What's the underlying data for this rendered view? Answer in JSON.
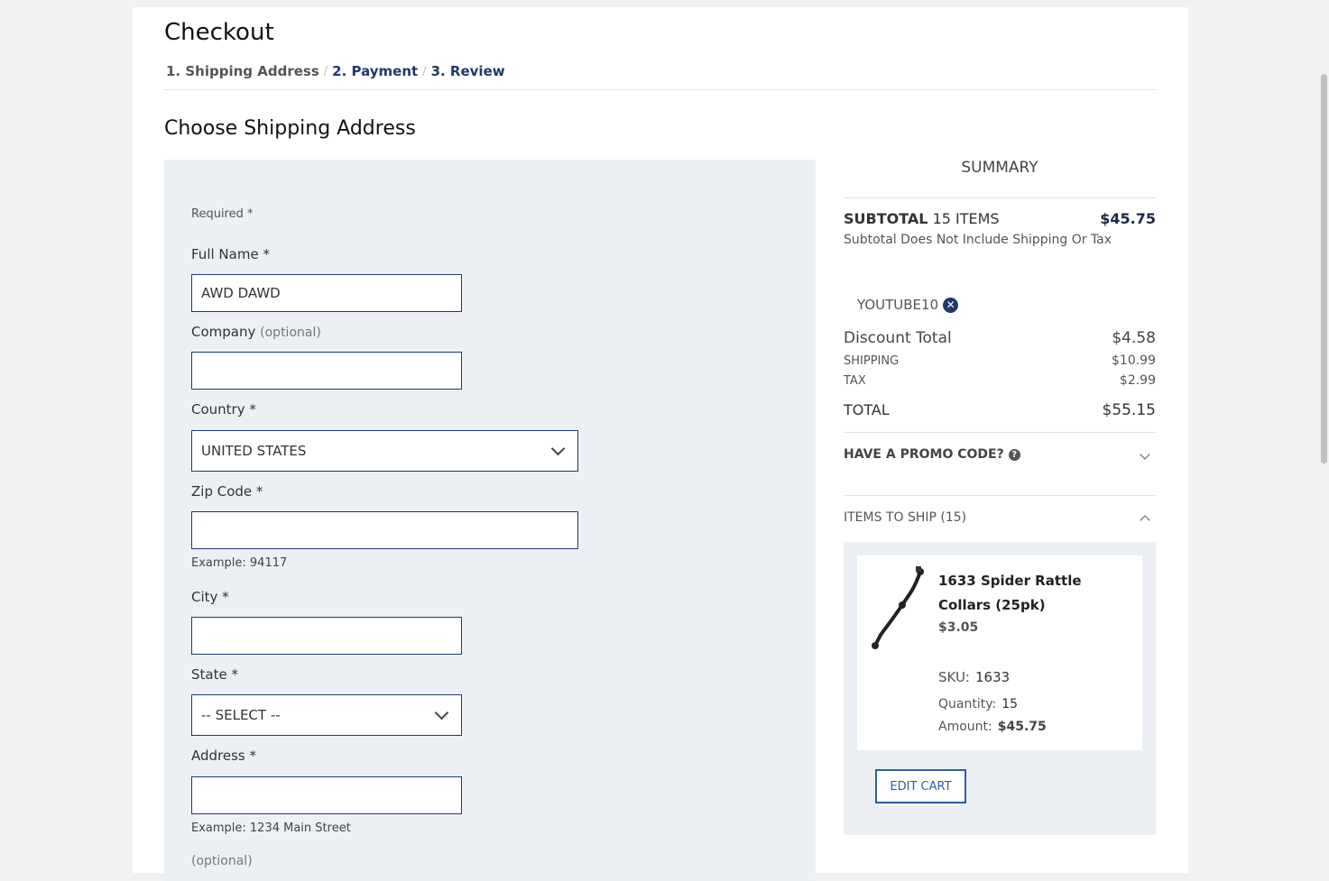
{
  "header": {
    "title": "Checkout",
    "steps": [
      "1. Shipping Address",
      "2. Payment",
      "3. Review"
    ],
    "separator": "/"
  },
  "section_title": "Choose Shipping Address",
  "form": {
    "required_note": "Required *",
    "full_name": {
      "label": "Full Name *",
      "value": "AWD DAWD"
    },
    "company": {
      "label": "Company",
      "optional": "(optional)",
      "value": ""
    },
    "country": {
      "label": "Country *",
      "value": "UNITED STATES"
    },
    "zip": {
      "label": "Zip Code *",
      "value": "",
      "hint": "Example: 94117"
    },
    "city": {
      "label": "City *",
      "value": ""
    },
    "state": {
      "label": "State *",
      "value": "-- SELECT --"
    },
    "address": {
      "label": "Address *",
      "value": "",
      "hint": "Example: 1234 Main Street"
    },
    "address2": {
      "label": "(optional)"
    }
  },
  "summary": {
    "title": "SUMMARY",
    "subtotal_label": "SUBTOTAL",
    "subtotal_items": "15 ITEMS",
    "subtotal_value": "$45.75",
    "subtotal_note": "Subtotal Does Not Include Shipping Or Tax",
    "coupon_code": "YOUTUBE10",
    "discount_label": "Discount Total",
    "discount_value": "$4.58",
    "shipping_label": "SHIPPING",
    "shipping_value": "$10.99",
    "tax_label": "TAX",
    "tax_value": "$2.99",
    "total_label": "TOTAL",
    "total_value": "$55.15",
    "promo_label": "HAVE A PROMO CODE?",
    "items_label": "ITEMS TO SHIP (15)",
    "edit_cart": "EDIT CART"
  },
  "item": {
    "name": "1633 Spider Rattle Collars (25pk)",
    "price": "$3.05",
    "sku_label": "SKU:",
    "sku": "1633",
    "qty_label": "Quantity:",
    "qty": "15",
    "amount_label": "Amount:",
    "amount": "$45.75"
  },
  "colors": {
    "accent": "#1f3a68",
    "panel": "#eceff3",
    "button": "#2d5f9e"
  }
}
